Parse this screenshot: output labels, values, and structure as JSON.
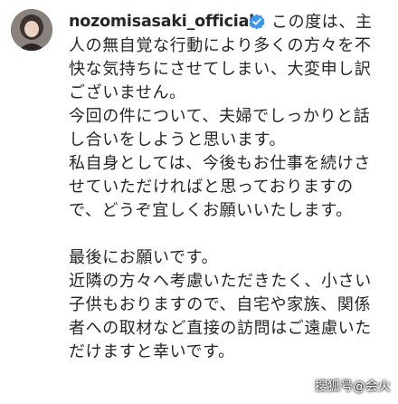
{
  "post": {
    "username": "nozomisasaki_official",
    "verified": true,
    "caption_lines": [
      "この度は、主",
      "人の無自覚な行動により多くの方々を不",
      "快な気持ちにさせてしまい、大変申し訳",
      "ございません。",
      "今回の件について、夫婦でしっかりと話",
      "し合いをしようと思います。",
      "私自身としては、今後もお仕事を続けさ",
      "せていただければと思っておりますの",
      "で、どうぞ宜しくお願いいたします。",
      "",
      "最後にお願いです。",
      "近隣の方々へ考慮いただきたく、小さい",
      "子供もおりますので、自宅や家族、関係",
      "者への取材など直接の訪問はご遠慮いた",
      "だけますと幸いです。"
    ]
  },
  "watermark": {
    "text": "搜狐号@会火"
  },
  "colors": {
    "verified_badge": "#3897f0",
    "text": "#262626"
  }
}
